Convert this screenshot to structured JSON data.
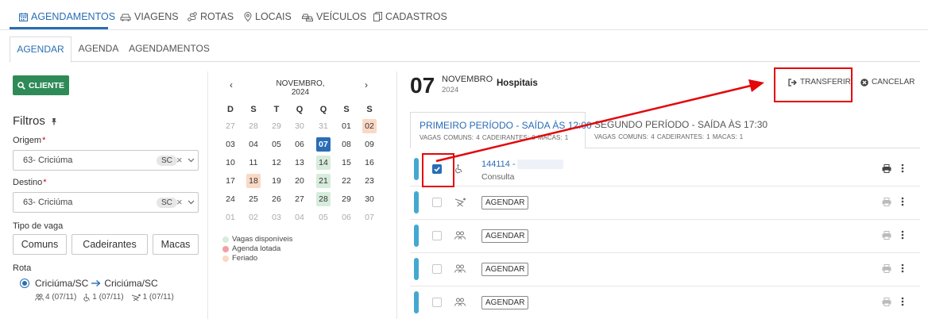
{
  "topnav": {
    "items": [
      {
        "label": "AGENDAMENTOS",
        "icon": "calendar-icon",
        "active": true
      },
      {
        "label": "VIAGENS",
        "icon": "car-icon",
        "active": false
      },
      {
        "label": "ROTAS",
        "icon": "route-icon",
        "active": false
      },
      {
        "label": "LOCAIS",
        "icon": "map-pin-icon",
        "active": false
      },
      {
        "label": "VEÍCULOS",
        "icon": "vehicles-icon",
        "active": false
      },
      {
        "label": "CADASTROS",
        "icon": "copy-icon",
        "active": false
      }
    ]
  },
  "subtabs": [
    {
      "label": "AGENDAR",
      "active": true
    },
    {
      "label": "AGENDA",
      "active": false
    },
    {
      "label": "AGENDAMENTOS",
      "active": false
    }
  ],
  "filters": {
    "cliente_button": "CLIENTE",
    "title": "Filtros",
    "origem": {
      "label": "Origem",
      "value": "63- Criciúma",
      "uf": "SC"
    },
    "destino": {
      "label": "Destino",
      "value": "63- Criciúma",
      "uf": "SC"
    },
    "tipo_vaga_label": "Tipo de vaga",
    "tipo_vaga_buttons": [
      "Comuns",
      "Cadeirantes",
      "Macas"
    ],
    "rota_label": "Rota",
    "rota": {
      "from": "Criciúma/SC",
      "to": "Criciúma/SC",
      "stats": [
        "4 (07/11)",
        "1 (07/11)",
        "1 (07/11)"
      ]
    }
  },
  "calendar": {
    "prev": "‹",
    "next": "›",
    "title": "NOVEMBRO, 2024",
    "weekdays": [
      "D",
      "S",
      "T",
      "Q",
      "Q",
      "S",
      "S"
    ],
    "weeks": [
      [
        {
          "d": "27",
          "s": "muted"
        },
        {
          "d": "28",
          "s": "muted"
        },
        {
          "d": "29",
          "s": "muted"
        },
        {
          "d": "30",
          "s": "muted"
        },
        {
          "d": "31",
          "s": "muted"
        },
        {
          "d": "01",
          "s": ""
        },
        {
          "d": "02",
          "s": "holiday"
        }
      ],
      [
        {
          "d": "03",
          "s": ""
        },
        {
          "d": "04",
          "s": ""
        },
        {
          "d": "05",
          "s": ""
        },
        {
          "d": "06",
          "s": ""
        },
        {
          "d": "07",
          "s": "today"
        },
        {
          "d": "08",
          "s": ""
        },
        {
          "d": "09",
          "s": ""
        }
      ],
      [
        {
          "d": "10",
          "s": ""
        },
        {
          "d": "11",
          "s": ""
        },
        {
          "d": "12",
          "s": ""
        },
        {
          "d": "13",
          "s": ""
        },
        {
          "d": "14",
          "s": "avail"
        },
        {
          "d": "15",
          "s": ""
        },
        {
          "d": "16",
          "s": ""
        }
      ],
      [
        {
          "d": "17",
          "s": ""
        },
        {
          "d": "18",
          "s": "holiday"
        },
        {
          "d": "19",
          "s": ""
        },
        {
          "d": "20",
          "s": ""
        },
        {
          "d": "21",
          "s": "avail"
        },
        {
          "d": "22",
          "s": ""
        },
        {
          "d": "23",
          "s": ""
        }
      ],
      [
        {
          "d": "24",
          "s": ""
        },
        {
          "d": "25",
          "s": ""
        },
        {
          "d": "26",
          "s": ""
        },
        {
          "d": "27",
          "s": ""
        },
        {
          "d": "28",
          "s": "avail"
        },
        {
          "d": "29",
          "s": ""
        },
        {
          "d": "30",
          "s": ""
        }
      ],
      [
        {
          "d": "01",
          "s": "muted"
        },
        {
          "d": "02",
          "s": "muted"
        },
        {
          "d": "03",
          "s": "muted"
        },
        {
          "d": "04",
          "s": "muted"
        },
        {
          "d": "05",
          "s": "muted"
        },
        {
          "d": "06",
          "s": "muted"
        },
        {
          "d": "07",
          "s": "muted"
        }
      ]
    ],
    "legend": [
      {
        "label": "Vagas disponíveis",
        "color": "#d7ecdc"
      },
      {
        "label": "Agenda lotada",
        "color": "#f2a0a0"
      },
      {
        "label": "Feriado",
        "color": "#fad9c4"
      }
    ]
  },
  "day": {
    "number": "07",
    "month": "NOVEMBRO",
    "year": "2024",
    "destination": "Hospitais"
  },
  "actions": {
    "transferir": "TRANSFERIR",
    "cancelar": "CANCELAR"
  },
  "periods": [
    {
      "title": "PRIMEIRO PERÍODO - SAÍDA ÀS 12:00",
      "stats": "VAGAS COMUNS: 4   CADEIRANTES: 0   MACAS: 1",
      "active": true
    },
    {
      "title": "SEGUNDO PERÍODO - SAÍDA ÀS 17:30",
      "stats": "VAGAS COMUNS: 4   CADEIRANTES: 1   MACAS: 1",
      "active": false
    }
  ],
  "rows": [
    {
      "checked": true,
      "icon": "wheelchair-icon",
      "id": "144114 -",
      "type": "Consulta"
    },
    {
      "checked": false,
      "icon": "stretcher-icon",
      "button": "AGENDAR"
    },
    {
      "checked": false,
      "icon": "people-icon",
      "button": "AGENDAR"
    },
    {
      "checked": false,
      "icon": "people-icon",
      "button": "AGENDAR"
    },
    {
      "checked": false,
      "icon": "people-icon",
      "button": "AGENDAR"
    }
  ],
  "colors": {
    "accent": "#2a6db5",
    "success": "#2e8b57",
    "row_bar": "#43a9d1",
    "annotation": "#e3060b"
  }
}
